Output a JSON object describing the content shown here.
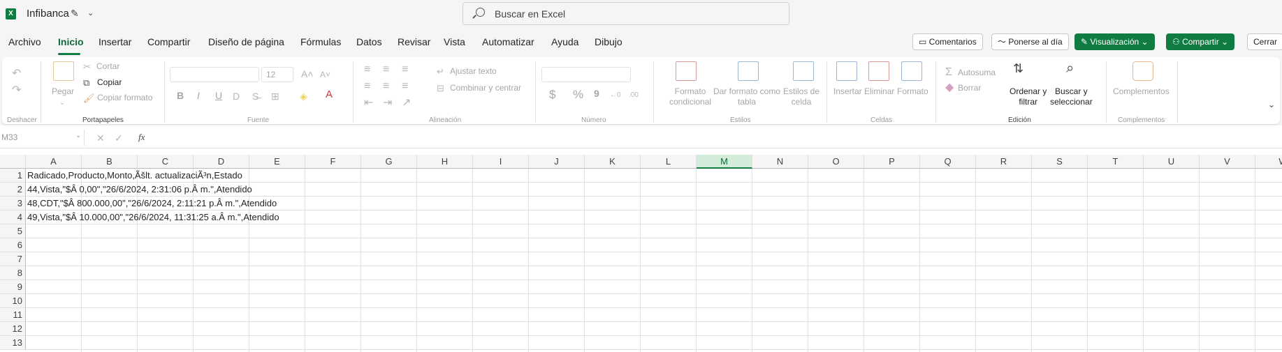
{
  "app": {
    "title": "Infibanca"
  },
  "search": {
    "placeholder": "Buscar en Excel"
  },
  "menu": {
    "tabs": [
      "Archivo",
      "Inicio",
      "Insertar",
      "Compartir",
      "Diseño de página",
      "Fórmulas",
      "Datos",
      "Revisar",
      "Vista",
      "Automatizar",
      "Ayuda",
      "Dibujo"
    ],
    "active": "Inicio"
  },
  "top_buttons": {
    "comments": "Comentarios",
    "catchup": "Ponerse al día",
    "view": "Visualización",
    "share": "Compartir",
    "close": "Cerrar"
  },
  "ribbon": {
    "undo_group": "Deshacer",
    "clipboard": {
      "paste": "Pegar",
      "cut": "Cortar",
      "copy": "Copiar",
      "format_painter": "Copiar formato",
      "group": "Portapapeles"
    },
    "font": {
      "size": "12",
      "group": "Fuente",
      "bold": "B",
      "italic": "I",
      "underline": "U"
    },
    "alignment": {
      "wrap": "Ajustar texto",
      "merge": "Combinar y centrar",
      "group": "Alineación"
    },
    "number": {
      "group": "Número",
      "currency": "$",
      "percent": "%",
      "comma": "9"
    },
    "styles": {
      "conditional": [
        "Formato",
        "condicional"
      ],
      "table": [
        "Dar formato como",
        "tabla"
      ],
      "cell_styles": [
        "Estilos de",
        "celda"
      ],
      "group": "Estilos"
    },
    "cells": {
      "insert": "Insertar",
      "delete": "Eliminar",
      "format": "Formato",
      "group": "Celdas"
    },
    "editing": {
      "autosum": "Autosuma",
      "clear": "Borrar",
      "sort": [
        "Ordenar y",
        "filtrar"
      ],
      "find": [
        "Buscar y",
        "seleccionar"
      ],
      "group": "Edición"
    },
    "addins": {
      "label": "Complementos",
      "group": "Complementos"
    }
  },
  "formula_bar": {
    "name_box": "M33",
    "fx": "fx",
    "value": ""
  },
  "grid": {
    "columns": [
      "A",
      "B",
      "C",
      "D",
      "E",
      "F",
      "G",
      "H",
      "I",
      "J",
      "K",
      "L",
      "M",
      "N",
      "O",
      "P",
      "Q",
      "R",
      "S",
      "T",
      "U",
      "V",
      "W"
    ],
    "selected_column": "M",
    "rows": [
      "1",
      "2",
      "3",
      "4",
      "5",
      "6",
      "7",
      "8",
      "9",
      "10",
      "11",
      "12",
      "13"
    ],
    "cells": [
      "Radicado,Producto,Monto,Ãšlt. actualizaciÃ³n,Estado",
      "44,Vista,\"$Â 0,00\",\"26/6/2024, 2:31:06 p.Â m.\",Atendido",
      "48,CDT,\"$Â 800.000,00\",\"26/6/2024, 2:11:21 p.Â m.\",Atendido",
      "49,Vista,\"$Â 10.000,00\",\"26/6/2024, 11:31:25 a.Â m.\",Atendido"
    ]
  },
  "colors": {
    "accent": "#107c41",
    "selected_header": "#d3ebd9"
  }
}
